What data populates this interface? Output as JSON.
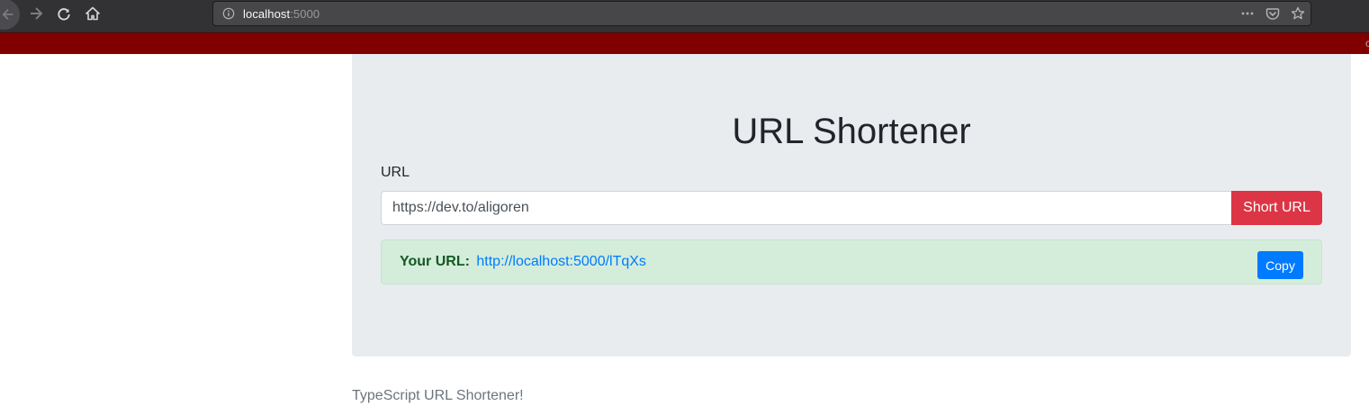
{
  "browser": {
    "url_host": "localhost",
    "url_port": ":5000",
    "icons": {
      "back": "arrow-left-icon",
      "forward": "arrow-right-icon",
      "reload": "reload-icon",
      "home": "home-icon",
      "info": "info-icon",
      "more": "more-icon",
      "pocket": "pocket-icon",
      "bookmark": "star-icon"
    }
  },
  "notification": {
    "clipped_text": "c"
  },
  "page": {
    "title": "URL Shortener",
    "url_label": "URL",
    "url_input_value": "https://dev.to/aligoren",
    "short_button_label": "Short URL",
    "result_label": "Your URL:",
    "result_link": "http://localhost:5000/lTqXs",
    "copy_button_label": "Copy",
    "footer": "TypeScript URL Shortener!"
  },
  "colors": {
    "notification_bar": "#800000",
    "jumbotron": "#e9ecef",
    "danger": "#dc3545",
    "primary": "#007bff",
    "success_bg": "#d4edda",
    "success_text": "#155724"
  }
}
